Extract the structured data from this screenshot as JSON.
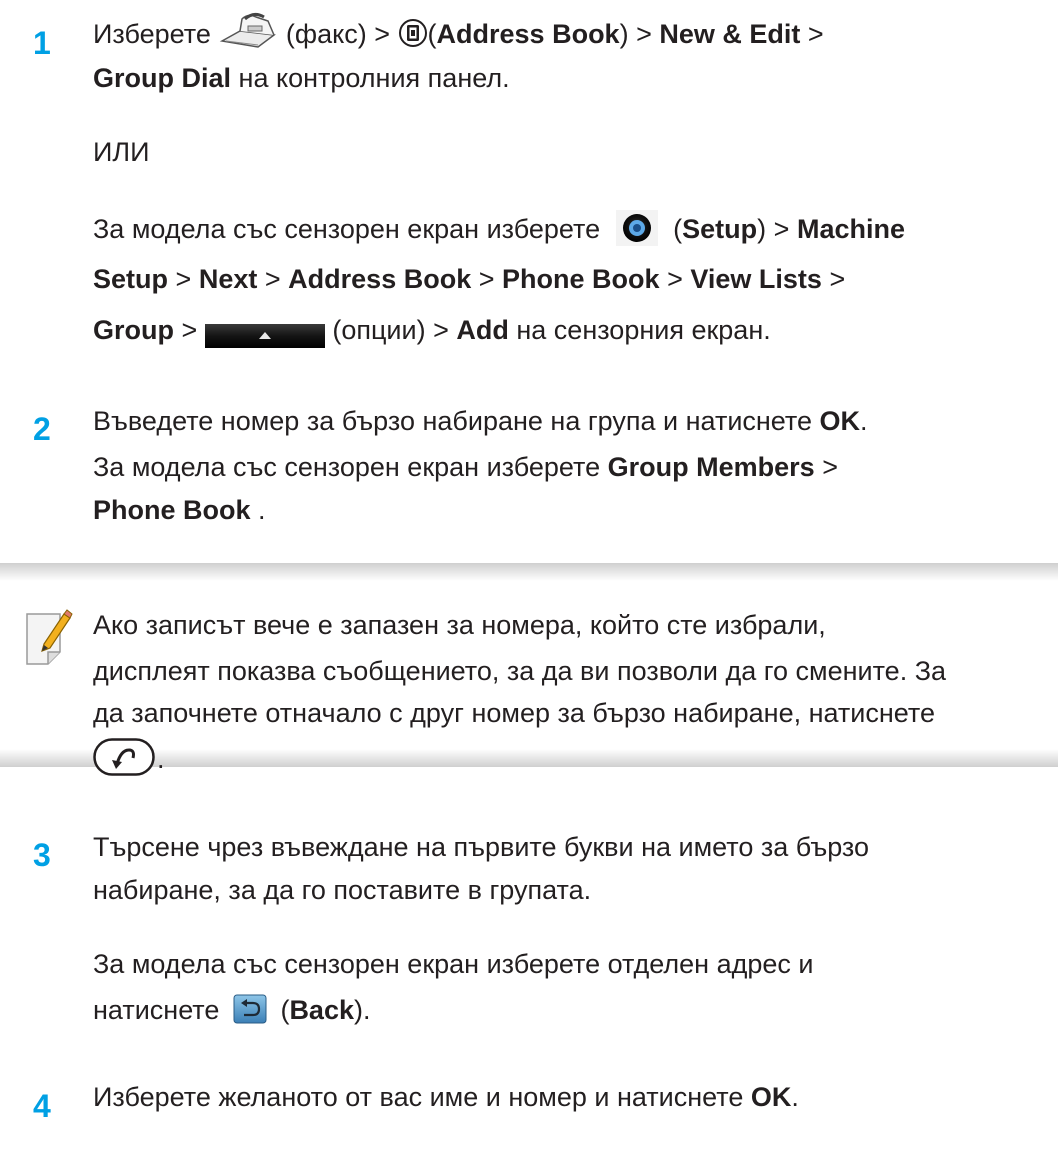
{
  "step1": {
    "number": "1",
    "line1": {
      "t1": "Изберете",
      "t2": "(факс) >",
      "t3": "(",
      "address_book": "Address Book",
      "t4": ") >",
      "new_edit": "New & Edit",
      "t5": ">"
    },
    "line2": {
      "group_dial": "Group Dial",
      "t1": "на контролния панел."
    },
    "or": "ИЛИ",
    "line4": {
      "t1": "За модела със сензорен екран изберете",
      "t2": "(",
      "setup": "Setup",
      "t3": ") >",
      "machine": "Machine"
    },
    "line5": {
      "setup": "Setup",
      "s1": ">",
      "next": "Next",
      "s2": ">",
      "address_book": "Address Book",
      "s3": ">",
      "phone_book": "Phone Book",
      "s4": ">",
      "view_lists": "View Lists",
      "s5": ">"
    },
    "line6": {
      "group": "Group",
      "s1": ">",
      "t1": "(опции) >",
      "add": "Add",
      "t2": "на сензорния екран."
    }
  },
  "step2": {
    "number": "2",
    "line1": {
      "t1": "Въведете номер за бързо набиране на група и натиснете",
      "ok": "OK",
      "t2": "."
    },
    "line2": {
      "t1": "За модела със сензорен екран изберете",
      "group_members": "Group Members",
      "t2": ">"
    },
    "line3": {
      "phone_book": "Phone Book",
      "t1": "."
    }
  },
  "note": {
    "line1": "Ако записът вече е запазен за номера, който сте избрали,",
    "line2": "дисплеят показва съобщението, за да ви позволи да го смените. За",
    "line3": "да започнете отначало с друг номер за бързо набиране, натиснете",
    "end": "."
  },
  "step3": {
    "number": "3",
    "line1": "Търсене чрез въвеждане на първите букви на името за бързо",
    "line2": "набиране, за да го поставите в групата.",
    "line3": "За модела със сензорен екран изберете отделен адрес и",
    "line4": {
      "t1": "натиснете",
      "t2": "(",
      "back": "Back",
      "t3": ")."
    }
  },
  "step4": {
    "number": "4",
    "line1": {
      "t1": "Изберете желаното от вас име и номер и натиснете",
      "ok": "OK",
      "t2": "."
    }
  },
  "colors": {
    "step_number": "#00a0e4",
    "text": "#231f20",
    "note_band_edge": "#cfcfcf"
  },
  "icons": [
    "fax-icon",
    "address-book-icon",
    "setup-gear-icon",
    "options-button-icon",
    "note-pencil-icon",
    "back-key-icon",
    "back-touch-icon"
  ]
}
